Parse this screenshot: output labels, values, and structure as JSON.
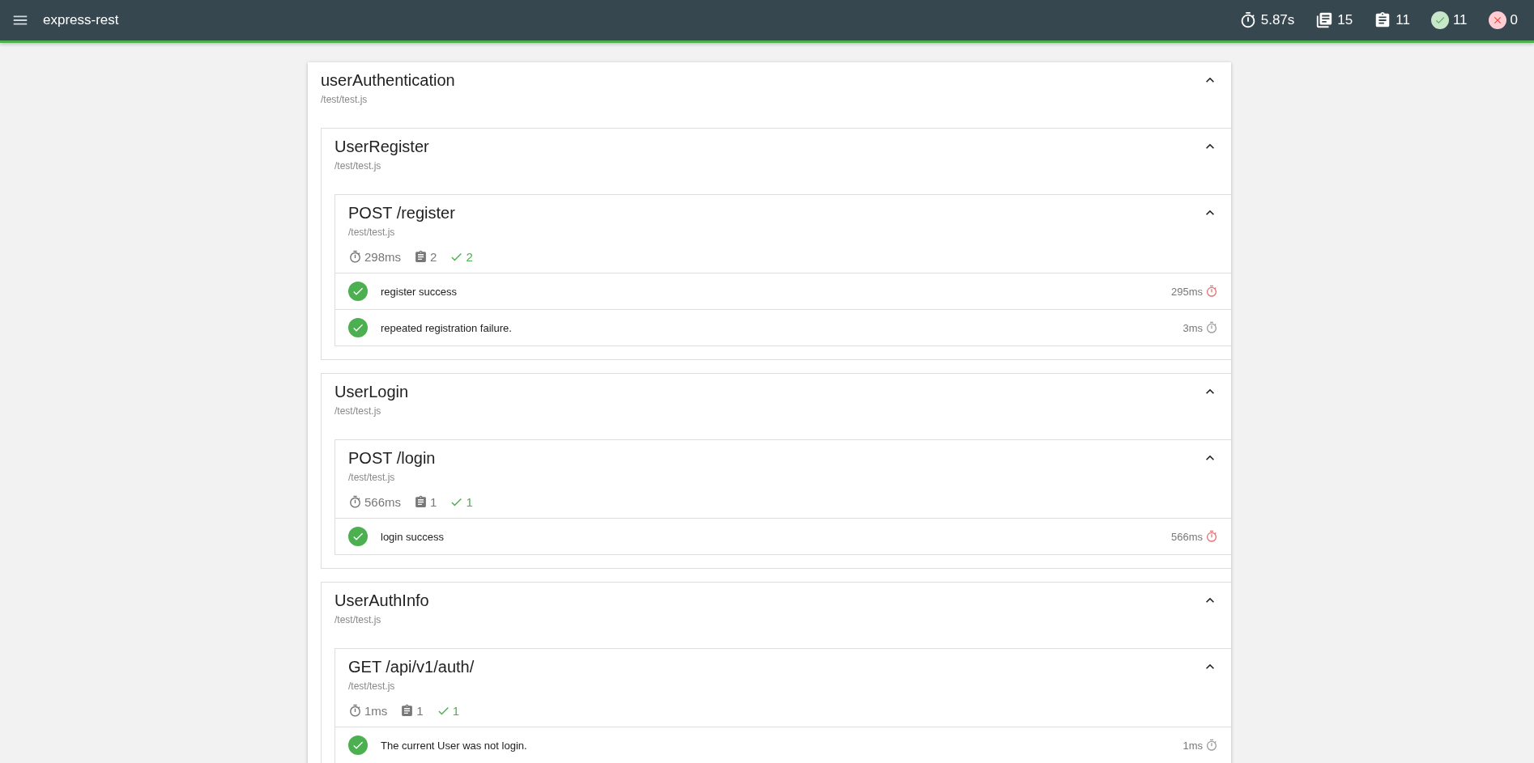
{
  "app_bar": {
    "title": "express-rest",
    "stats": [
      {
        "kind": "duration",
        "value": "5.87s"
      },
      {
        "kind": "suites",
        "value": "15"
      },
      {
        "kind": "tests",
        "value": "11"
      },
      {
        "kind": "passes",
        "value": "11"
      },
      {
        "kind": "failures",
        "value": "0"
      }
    ]
  },
  "suites": [
    {
      "title": "userAuthentication",
      "file": "/test/test.js",
      "expanded": true,
      "children": [
        {
          "title": "UserRegister",
          "file": "/test/test.js",
          "expanded": true,
          "children": [
            {
              "title": "POST /register",
              "file": "/test/test.js",
              "expanded": true,
              "stats": {
                "duration": "298ms",
                "tests": "2",
                "passes": "2"
              },
              "tests": [
                {
                  "title": "register success",
                  "passed": true,
                  "duration": "295ms",
                  "slow": true
                },
                {
                  "title": "repeated registration failure.",
                  "passed": true,
                  "duration": "3ms",
                  "slow": false
                }
              ]
            }
          ]
        },
        {
          "title": "UserLogin",
          "file": "/test/test.js",
          "expanded": true,
          "children": [
            {
              "title": "POST /login",
              "file": "/test/test.js",
              "expanded": true,
              "stats": {
                "duration": "566ms",
                "tests": "1",
                "passes": "1"
              },
              "tests": [
                {
                  "title": "login success",
                  "passed": true,
                  "duration": "566ms",
                  "slow": true
                }
              ]
            }
          ]
        },
        {
          "title": "UserAuthInfo",
          "file": "/test/test.js",
          "expanded": true,
          "children": [
            {
              "title": "GET /api/v1/auth/",
              "file": "/test/test.js",
              "expanded": true,
              "stats": {
                "duration": "1ms",
                "tests": "1",
                "passes": "1"
              },
              "tests": [
                {
                  "title": "The current User was not login.",
                  "passed": true,
                  "duration": "1ms",
                  "slow": false
                }
              ]
            }
          ]
        }
      ]
    }
  ]
}
